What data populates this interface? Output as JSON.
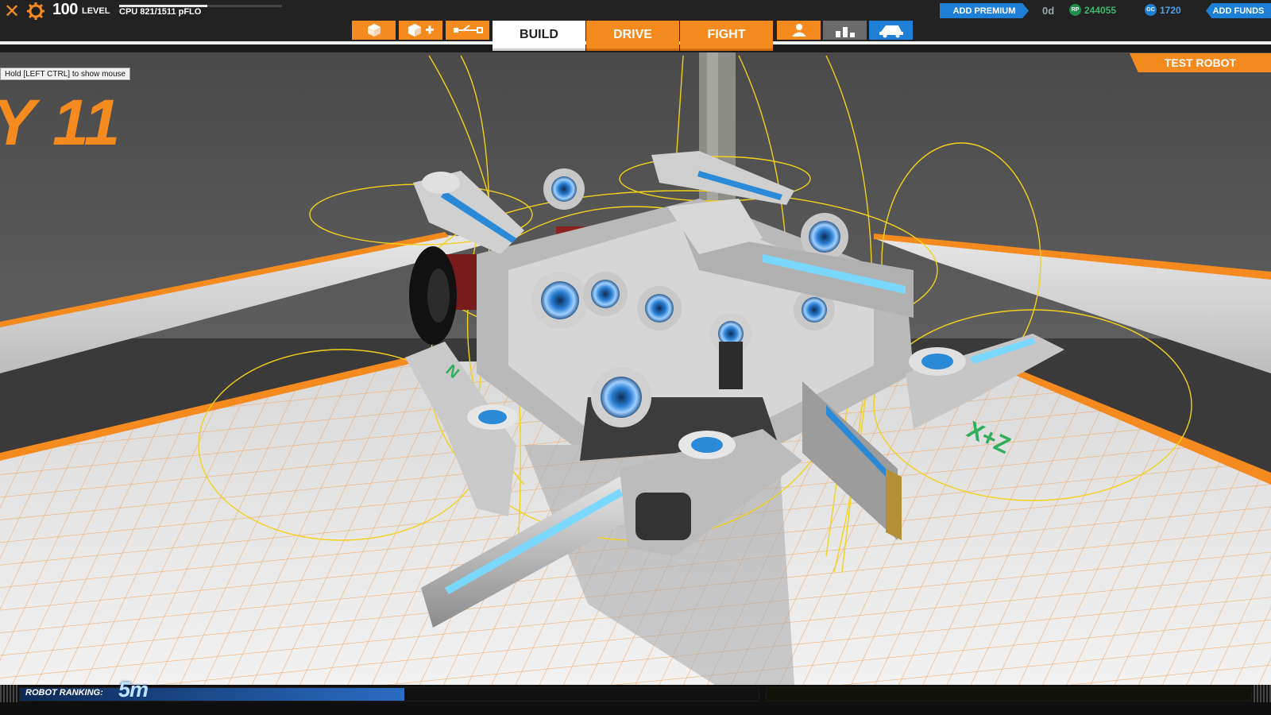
{
  "hud": {
    "close_icon": "close-icon",
    "settings_icon": "gear-icon",
    "level_value": "100",
    "level_label": "LEVEL",
    "cpu_text": "CPU 821/1511 pFLO",
    "cpu_fraction": 0.543
  },
  "tools": [
    {
      "name": "cube-icon",
      "color": "#f58a1f"
    },
    {
      "name": "add-cube-icon",
      "color": "#f58a1f"
    },
    {
      "name": "connect-icon",
      "color": "#f58a1f"
    },
    {
      "name": "user-icon",
      "color": "#f58a1f"
    },
    {
      "name": "bar-chart-icon",
      "color": "#6b6b6b"
    },
    {
      "name": "vehicle-icon",
      "color": "#1e7fd6"
    }
  ],
  "modes": {
    "build": "BUILD",
    "drive": "DRIVE",
    "fight": "FIGHT",
    "active": "BUILD"
  },
  "account": {
    "add_premium": "ADD PREMIUM",
    "premium_days": "0d",
    "rp_icon_text": "RP",
    "rp_value": "244055",
    "gc_icon_text": "GC",
    "gc_value": "1720",
    "add_funds": "ADD FUNDS"
  },
  "test_robot": "TEST ROBOT",
  "hint": "Hold [LEFT CTRL] to show mouse",
  "scene_labels": {
    "wall_text": "Y 11",
    "floor_axis": "X+Z"
  },
  "ranking": {
    "label": "ROBOT RANKING:",
    "value": "5m",
    "fill_fraction": 0.52
  },
  "colors": {
    "accent_orange": "#f58a1f",
    "accent_blue": "#1e7fd6",
    "rp_green": "#3fb56c",
    "gizmo_yellow": "#f2d21a"
  }
}
